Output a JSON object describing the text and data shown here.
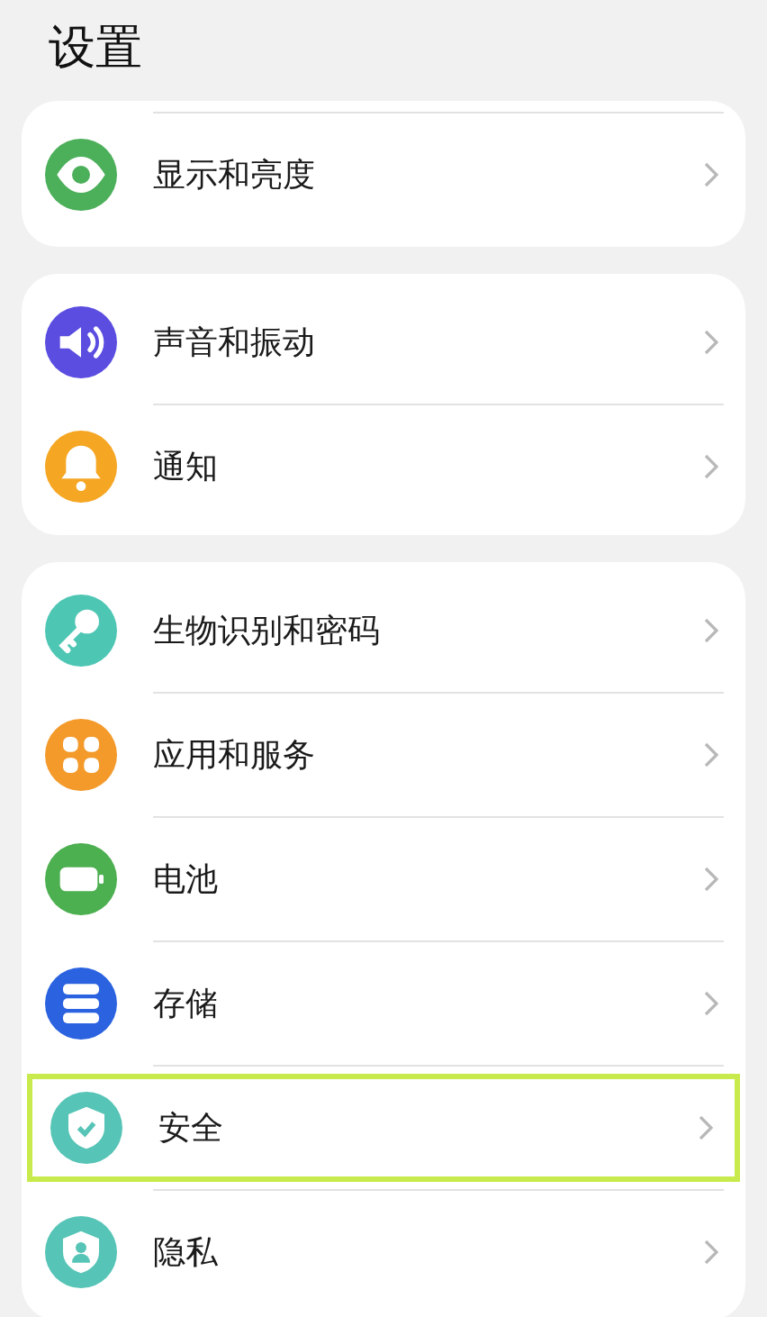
{
  "title": "设置",
  "groups": [
    {
      "items": [
        {
          "label": "显示和亮度",
          "kind": "eye",
          "color": "#4caf5a",
          "highlighted": false
        }
      ]
    },
    {
      "items": [
        {
          "label": "声音和振动",
          "kind": "speaker",
          "color": "#5a4de0",
          "highlighted": false
        },
        {
          "label": "通知",
          "kind": "bell",
          "color": "#f5a623",
          "highlighted": false
        }
      ]
    },
    {
      "items": [
        {
          "label": "生物识别和密码",
          "kind": "key",
          "color": "#4ec6b4",
          "highlighted": false
        },
        {
          "label": "应用和服务",
          "kind": "apps",
          "color": "#f39a2b",
          "highlighted": false
        },
        {
          "label": "电池",
          "kind": "battery",
          "color": "#4caf50",
          "highlighted": false
        },
        {
          "label": "存储",
          "kind": "storage",
          "color": "#2a62e0",
          "highlighted": false
        },
        {
          "label": "安全",
          "kind": "shield",
          "color": "#56c4b6",
          "highlighted": true
        },
        {
          "label": "隐私",
          "kind": "privacy",
          "color": "#56c4b6",
          "highlighted": false
        }
      ]
    }
  ]
}
